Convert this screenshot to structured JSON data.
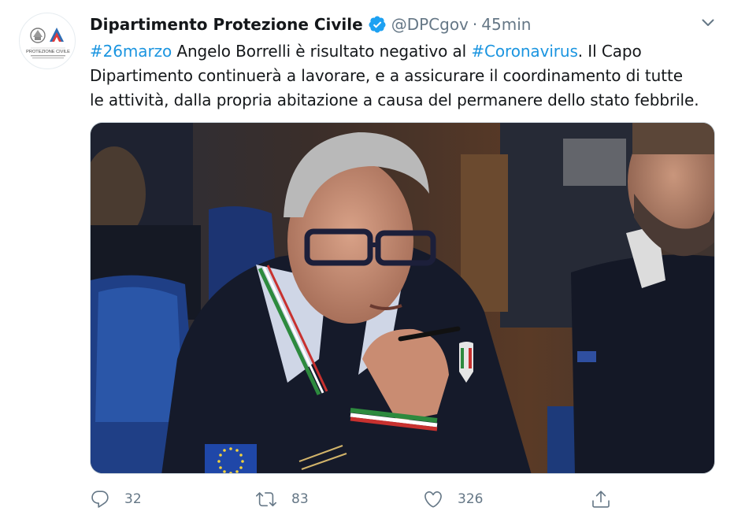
{
  "tweet": {
    "author": {
      "display_name": "Dipartimento Protezione Civile",
      "handle": "@DPCgov",
      "verified": true,
      "avatar_icon": "protezione-civile-logo",
      "avatar_text": "PROTEZIONE CIVILE"
    },
    "separator": "·",
    "time": "45min",
    "text": {
      "line1_hashtag": "#26marzo",
      "line1_mid": " Angelo Borrelli è risultato negativo al ",
      "line1_hashtag2": "#Coronavirus",
      "line1_end": ". Il Capo",
      "line2": "Dipartimento continuerà a lavorare, e a assicurare il coordinamento di tutte",
      "line3": "le attività, dalla propria abitazione a causa del permanere dello stato febbrile."
    },
    "media": {
      "type": "photo"
    },
    "actions": {
      "reply": {
        "icon": "reply-icon",
        "count": "32"
      },
      "retweet": {
        "icon": "retweet-icon",
        "count": "83"
      },
      "like": {
        "icon": "heart-icon",
        "count": "326"
      },
      "share": {
        "icon": "share-icon"
      }
    }
  },
  "colors": {
    "link": "#1b95e0",
    "secondary_text": "#657786",
    "verified": "#1da1f2"
  }
}
